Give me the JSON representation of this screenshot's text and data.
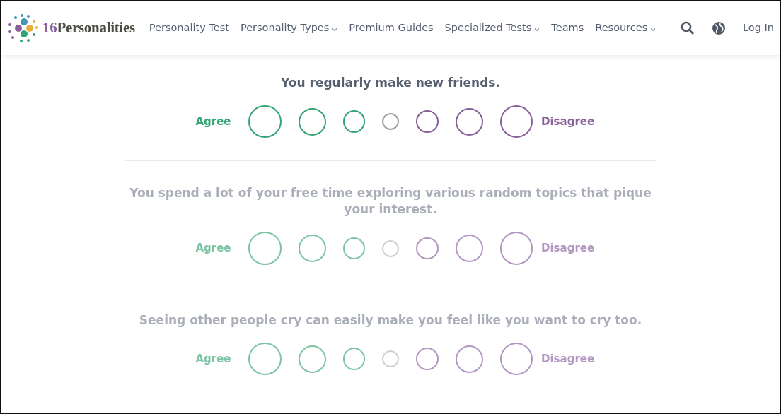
{
  "brand": {
    "name": "16Personalities"
  },
  "nav": [
    {
      "label": "Personality Test",
      "dropdown": false
    },
    {
      "label": "Personality Types",
      "dropdown": true
    },
    {
      "label": "Premium Guides",
      "dropdown": false
    },
    {
      "label": "Specialized Tests",
      "dropdown": true
    },
    {
      "label": "Teams",
      "dropdown": false
    },
    {
      "label": "Resources",
      "dropdown": true
    }
  ],
  "login": "Log In",
  "questions": [
    {
      "text": "You regularly make new friends.",
      "active": true,
      "agree": "Agree",
      "disagree": "Disagree",
      "options": [
        {
          "kind": "agree",
          "selected": false
        },
        {
          "kind": "agree",
          "selected": false
        },
        {
          "kind": "agree",
          "selected": false
        },
        {
          "kind": "neutral",
          "selected": false
        },
        {
          "kind": "disagree",
          "selected": false
        },
        {
          "kind": "disagree",
          "selected": false
        },
        {
          "kind": "disagree",
          "selected": false
        }
      ]
    },
    {
      "text": "You spend a lot of your free time exploring various random topics that pique your interest.",
      "active": false,
      "agree": "Agree",
      "disagree": "Disagree",
      "options": [
        {
          "kind": "agree",
          "selected": false
        },
        {
          "kind": "agree",
          "selected": false
        },
        {
          "kind": "agree",
          "selected": false
        },
        {
          "kind": "neutral",
          "selected": false
        },
        {
          "kind": "disagree",
          "selected": false
        },
        {
          "kind": "disagree",
          "selected": false
        },
        {
          "kind": "disagree",
          "selected": false
        }
      ]
    },
    {
      "text": "Seeing other people cry can easily make you feel like you want to cry too.",
      "active": false,
      "agree": "Agree",
      "disagree": "Disagree",
      "options": [
        {
          "kind": "agree",
          "selected": false
        },
        {
          "kind": "agree",
          "selected": false
        },
        {
          "kind": "agree",
          "selected": false
        },
        {
          "kind": "neutral",
          "selected": false
        },
        {
          "kind": "disagree",
          "selected": false
        },
        {
          "kind": "disagree",
          "selected": false
        },
        {
          "kind": "disagree",
          "selected": false
        }
      ]
    }
  ]
}
